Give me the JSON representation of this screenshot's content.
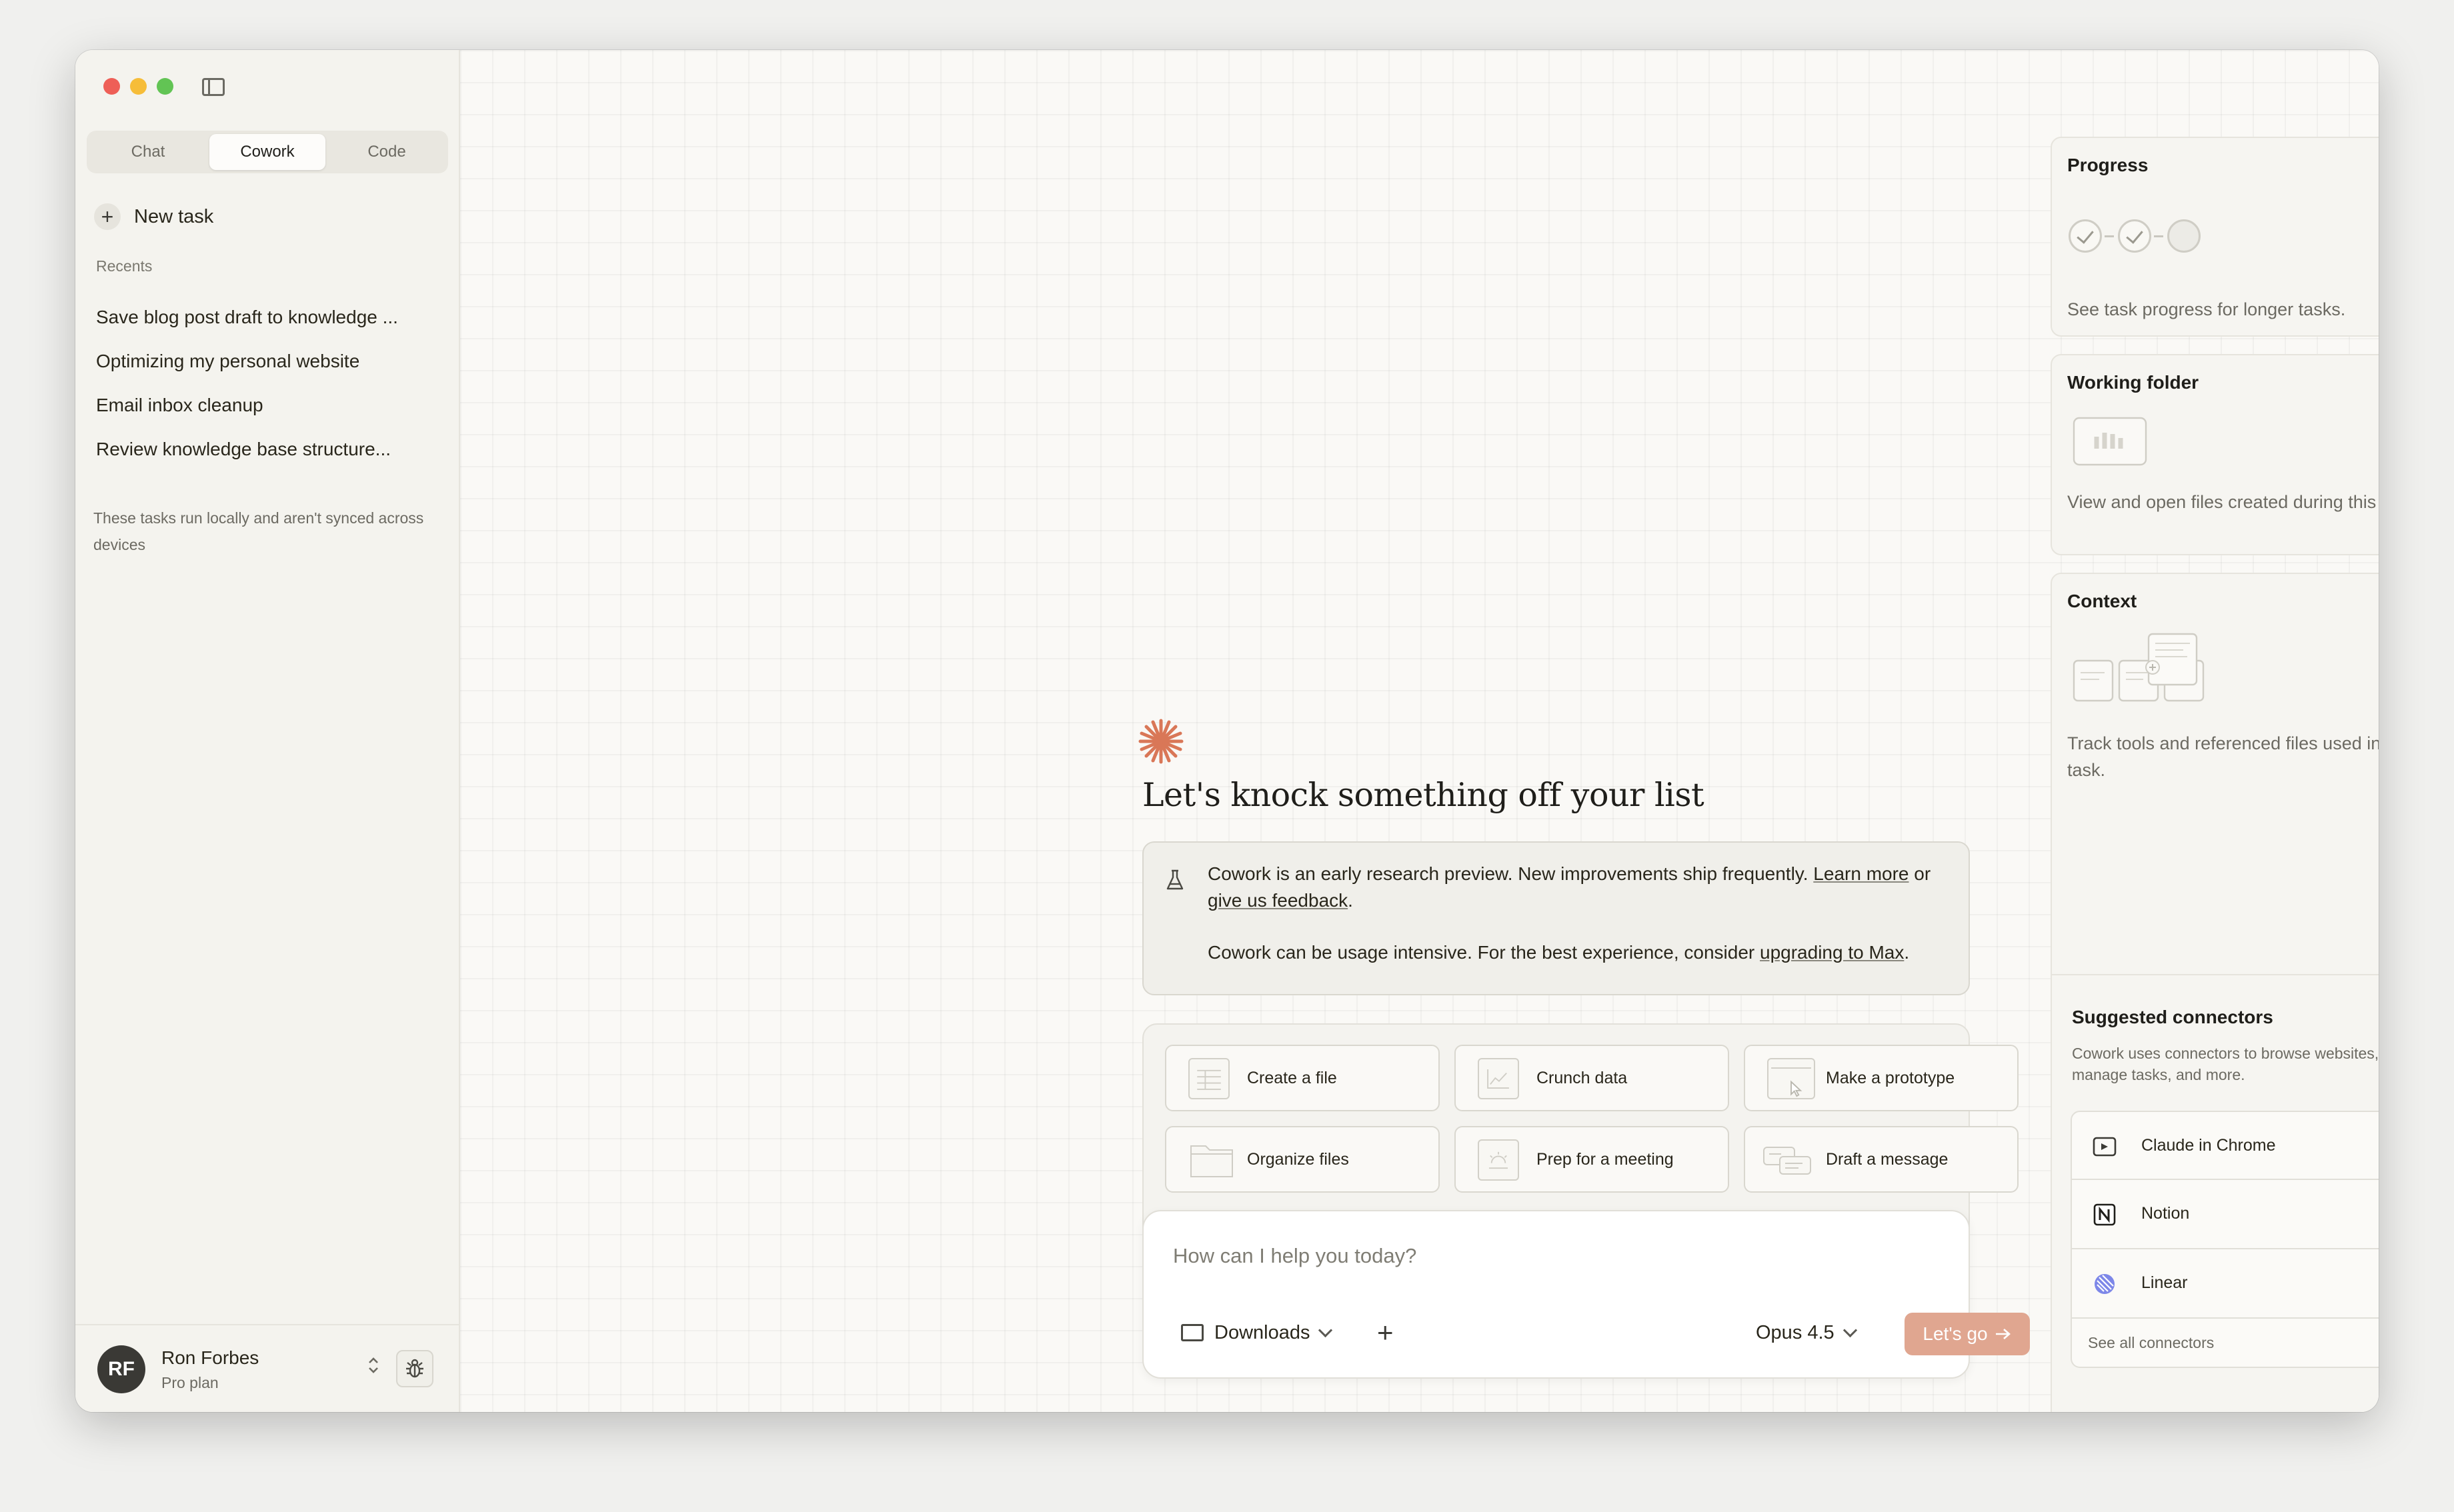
{
  "sidebar": {
    "mode_tabs": [
      {
        "label": "Chat",
        "active": false
      },
      {
        "label": "Cowork",
        "active": true
      },
      {
        "label": "Code",
        "active": false
      }
    ],
    "new_task_label": "New task",
    "recents_label": "Recents",
    "recents": [
      "Save blog post draft to knowledge ...",
      "Optimizing my personal website",
      "Email inbox cleanup",
      "Review knowledge base structure..."
    ],
    "note": "These tasks run locally and aren't synced across devices",
    "user": {
      "initials": "RF",
      "name": "Ron Forbes",
      "plan": "Pro plan"
    }
  },
  "main": {
    "title": "Let's knock something off your list",
    "notice": {
      "line1_pre": "Cowork is an early research preview. New improvements ship frequently.",
      "learn_more": "Learn more",
      "or": "or",
      "feedback": "give us feedback",
      "period": ".",
      "line2_pre": "Cowork can be usage intensive. For the best experience, consider",
      "upgrade": "upgrading to Max",
      "line2_post": "."
    },
    "actions": [
      {
        "label": "Create a file",
        "icon": "spreadsheet-icon"
      },
      {
        "label": "Crunch data",
        "icon": "chart-icon"
      },
      {
        "label": "Make a prototype",
        "icon": "window-cursor-icon"
      },
      {
        "label": "Organize files",
        "icon": "folder-icon"
      },
      {
        "label": "Prep for a meeting",
        "icon": "calendar-icon"
      },
      {
        "label": "Draft a message",
        "icon": "chat-bubbles-icon"
      }
    ],
    "composer": {
      "placeholder": "How can I help you today?",
      "folder": "Downloads",
      "model": "Opus 4.5",
      "submit": "Let's go"
    }
  },
  "right_panel": {
    "progress": {
      "title": "Progress",
      "desc": "See task progress for longer tasks.",
      "steps_done": 2,
      "steps_total": 3
    },
    "working_folder": {
      "title": "Working folder",
      "desc": "View and open files created during this task."
    },
    "context": {
      "title": "Context",
      "desc": "Track tools and referenced files used in this task."
    },
    "connectors": {
      "title": "Suggested connectors",
      "desc": "Cowork uses connectors to browse websites, manage tasks, and more.",
      "items": [
        {
          "name": "Claude in Chrome",
          "icon": "chrome-extension-icon"
        },
        {
          "name": "Notion",
          "icon": "notion-icon"
        },
        {
          "name": "Linear",
          "icon": "linear-icon"
        }
      ],
      "see_all": "See all connectors"
    }
  },
  "colors": {
    "accent": "#d97757",
    "go_button": "#e0a690",
    "traffic_red": "#ee5f57",
    "traffic_yellow": "#f6bd39",
    "traffic_green": "#62c454"
  }
}
